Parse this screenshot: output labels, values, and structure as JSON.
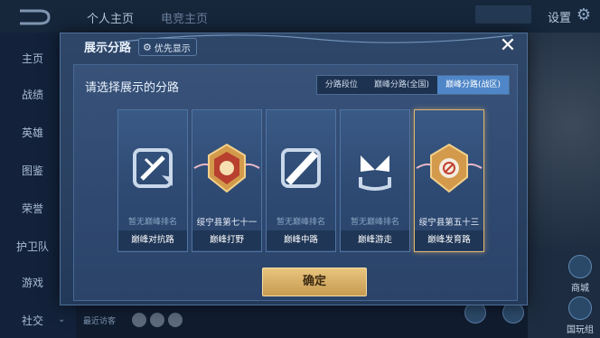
{
  "topbar": {
    "tab_profile": "个人主页",
    "tab_other": "电竞主页",
    "settings_label": "设置"
  },
  "sidebar": {
    "items": [
      "主页",
      "战绩",
      "英雄",
      "图鉴",
      "荣誉",
      "护卫队",
      "游戏",
      "社交"
    ]
  },
  "right_buttons": [
    "商城",
    "国玩组"
  ],
  "bottom": {
    "recent_visitors": "最近访客"
  },
  "modal": {
    "title": "展示分路",
    "priority_label": "优先显示",
    "close_label": "✕",
    "subtitle": "请选择展示的分路",
    "tabs": [
      {
        "label": "分路段位",
        "active": false
      },
      {
        "label": "巅峰分路(全国)",
        "active": false
      },
      {
        "label": "巅峰分路(战区)",
        "active": true
      }
    ],
    "cards": [
      {
        "rank": "暂无巅峰排名",
        "name": "巅峰对抗路",
        "icon": "sword-shield-icon",
        "ranked": false,
        "selected": false
      },
      {
        "rank": "绥宁县第七十一",
        "name": "巅峰打野",
        "icon": "gold-jungle-badge-icon",
        "ranked": true,
        "selected": false
      },
      {
        "rank": "暂无巅峰排名",
        "name": "巅峰中路",
        "icon": "mid-lane-slash-icon",
        "ranked": false,
        "selected": false
      },
      {
        "rank": "暂无巅峰排名",
        "name": "巅峰游走",
        "icon": "wings-support-icon",
        "ranked": false,
        "selected": false
      },
      {
        "rank": "绥宁县第五十三",
        "name": "巅峰发育路",
        "icon": "gold-adc-badge-icon",
        "ranked": true,
        "selected": true
      }
    ],
    "confirm_label": "确定"
  },
  "colors": {
    "accent_tab": "#4e86c8",
    "gold": "#e2b771",
    "panel": "#2e4668"
  }
}
